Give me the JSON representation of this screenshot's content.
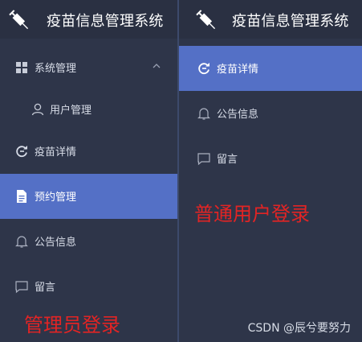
{
  "left": {
    "app_title": "疫苗信息管理系统",
    "menu": {
      "system": "系统管理",
      "users": "用户管理",
      "vaccine": "疫苗详情",
      "booking": "预约管理",
      "notice": "公告信息",
      "message": "留言"
    },
    "caption": "管理员登录"
  },
  "right": {
    "app_title": "疫苗信息管理系统",
    "menu": {
      "vaccine": "疫苗详情",
      "notice": "公告信息",
      "message": "留言"
    },
    "caption": "普通用户登录"
  },
  "watermark": "CSDN @辰兮要努力",
  "colors": {
    "sidebar_bg": "#2e3549",
    "active_bg": "#5470c6",
    "caption": "#e22424"
  },
  "icons": [
    "syringe-icon",
    "grid-icon",
    "chevron-up-icon",
    "user-icon",
    "refresh-icon",
    "document-icon",
    "bell-icon",
    "chat-icon"
  ]
}
